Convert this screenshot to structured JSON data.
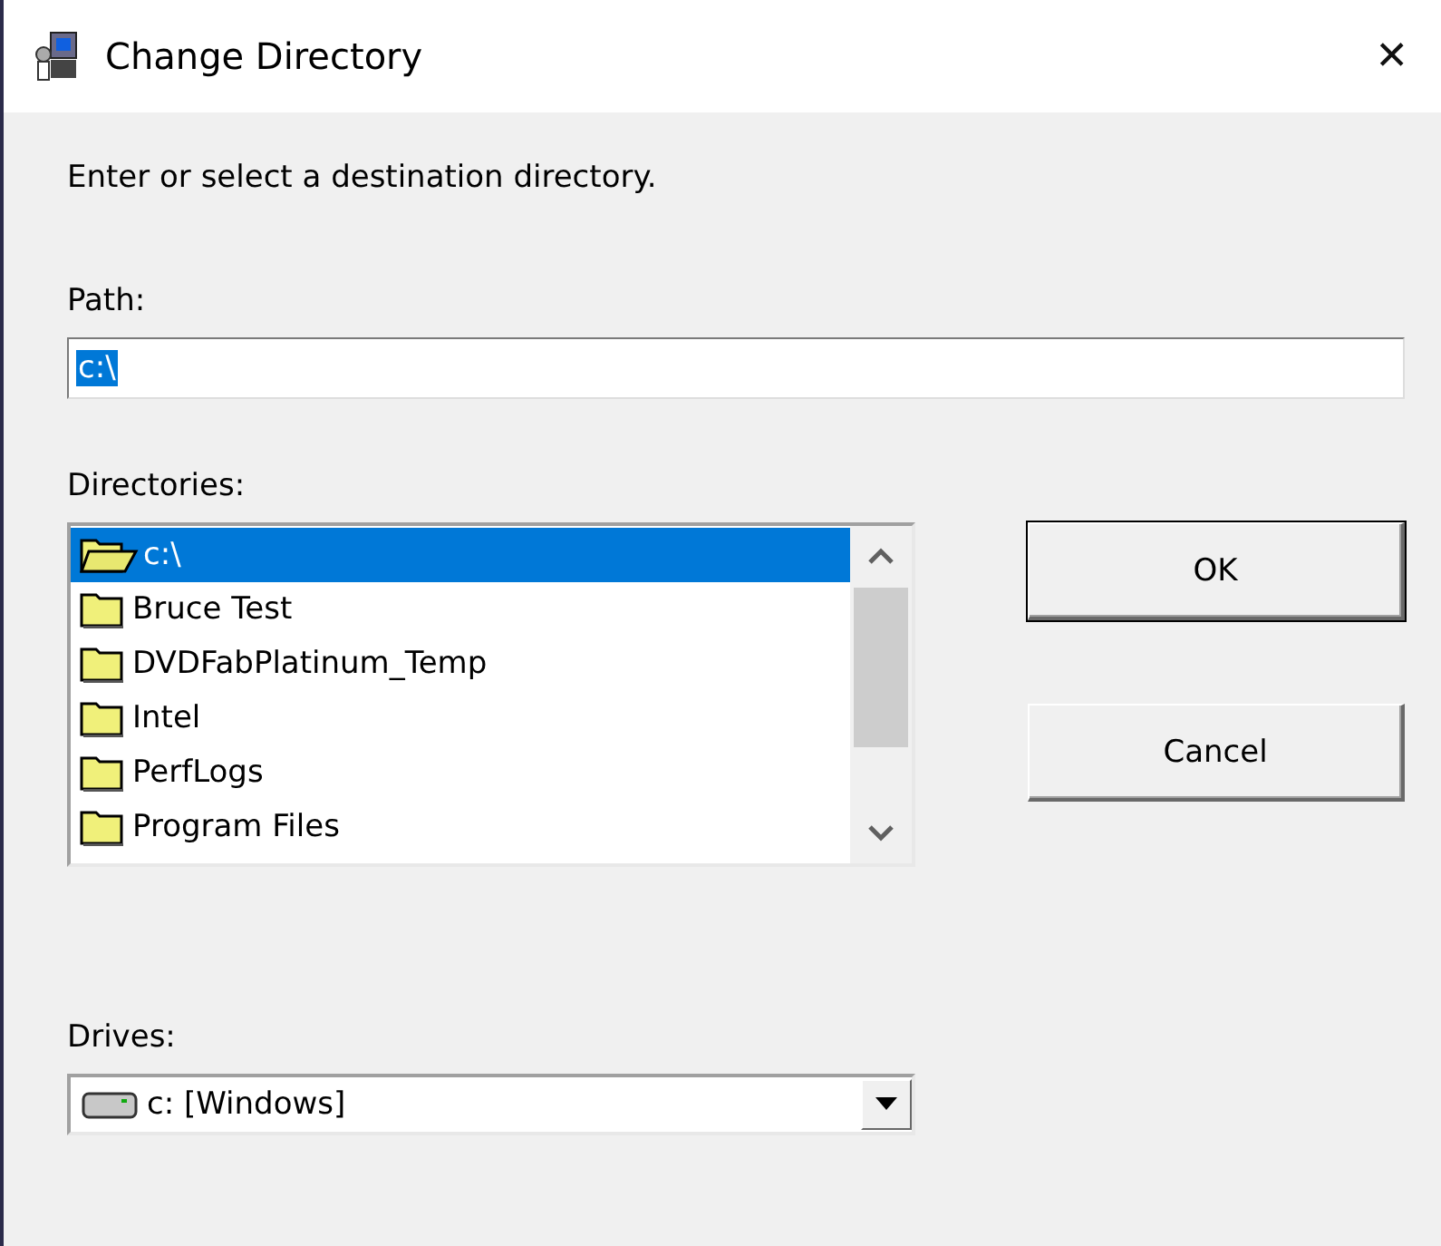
{
  "window": {
    "title": "Change Directory",
    "close": "✕"
  },
  "prompt": "Enter or select a destination directory.",
  "path": {
    "label": "Path:",
    "value": "c:\\",
    "value_selected": true
  },
  "directories": {
    "label": "Directories:",
    "items": [
      {
        "name": "c:\\",
        "kind": "open-folder",
        "selected": true
      },
      {
        "name": "Bruce Test",
        "kind": "folder",
        "selected": false
      },
      {
        "name": "DVDFabPlatinum_Temp",
        "kind": "folder",
        "selected": false
      },
      {
        "name": "Intel",
        "kind": "folder",
        "selected": false
      },
      {
        "name": "PerfLogs",
        "kind": "folder",
        "selected": false
      },
      {
        "name": "Program Files",
        "kind": "folder",
        "selected": false
      }
    ]
  },
  "buttons": [
    {
      "label": "OK",
      "default": true
    },
    {
      "label": "Cancel",
      "default": false
    }
  ],
  "drives": {
    "label": "Drives:",
    "value": "c: [Windows]"
  }
}
